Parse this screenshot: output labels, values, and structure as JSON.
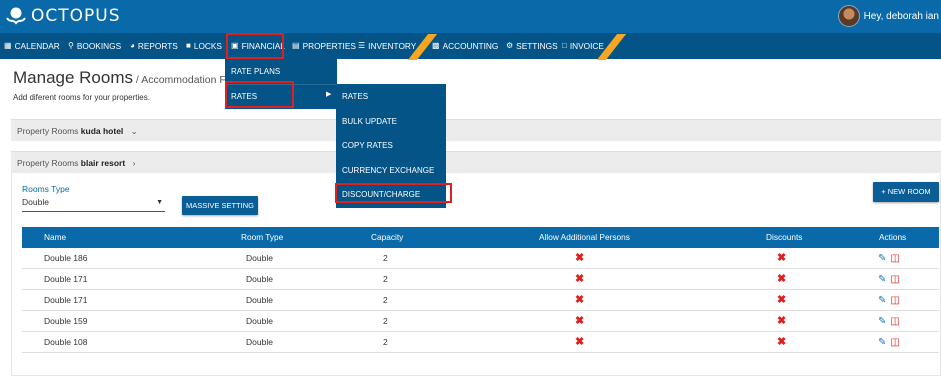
{
  "app": {
    "name": "OCTOPUS",
    "user_greeting": "Hey, deborah ian"
  },
  "colors": {
    "topbar": "#0a6aa9",
    "navbar": "#055487",
    "highlight": "#e0201d",
    "ribbon": "#f6a623"
  },
  "nav": [
    {
      "label": "CALENDAR",
      "icon": "calendar-icon"
    },
    {
      "label": "BOOKINGS",
      "icon": "search-icon"
    },
    {
      "label": "REPORTS",
      "icon": "pie-chart-icon"
    },
    {
      "label": "LOCKS",
      "icon": "lock-icon"
    },
    {
      "label": "FINANCIAL",
      "icon": "folder-open-icon"
    },
    {
      "label": "PROPERTIES",
      "icon": "book-icon"
    },
    {
      "label": "INVENTORY",
      "icon": "list-icon"
    },
    {
      "label": "ACCOUNTING",
      "icon": "calculator-icon"
    },
    {
      "label": "SETTINGS",
      "icon": "gear-icon"
    },
    {
      "label": "INVOICE",
      "icon": "file-icon"
    }
  ],
  "financial_menu": {
    "items": [
      "RATE PLANS",
      "RATES"
    ]
  },
  "rates_submenu": {
    "items": [
      "RATES",
      "BULK UPDATE",
      "COPY RATES",
      "CURRENCY EXCHANGE",
      "DISCOUNT/CHARGE"
    ]
  },
  "page": {
    "title": "Manage Rooms",
    "subtitle": " / Accommodation Facilit",
    "description": "Add diferent rooms for your properties."
  },
  "properties": [
    {
      "prefix": "Property Rooms ",
      "name": "kuda hotel",
      "chevron": "chevron-down-icon"
    },
    {
      "prefix": "Property Rooms ",
      "name": "blair resort",
      "chevron": "chevron-right-icon"
    }
  ],
  "filters": {
    "rooms_type_label": "Rooms Type",
    "rooms_type_value": "Double"
  },
  "buttons": {
    "massive_setting": "MASSIVE SETTING",
    "new_room": "+ NEW ROOM"
  },
  "table": {
    "headers": [
      "Name",
      "Room Type",
      "Capacity",
      "Allow Additional Persons",
      "Discounts",
      "Actions"
    ],
    "rows": [
      {
        "name": "Double 186",
        "room_type": "Double",
        "capacity": "2"
      },
      {
        "name": "Double 171",
        "room_type": "Double",
        "capacity": "2"
      },
      {
        "name": "Double 171",
        "room_type": "Double",
        "capacity": "2"
      },
      {
        "name": "Double 159",
        "room_type": "Double",
        "capacity": "2"
      },
      {
        "name": "Double 108",
        "room_type": "Double",
        "capacity": "2"
      }
    ]
  }
}
